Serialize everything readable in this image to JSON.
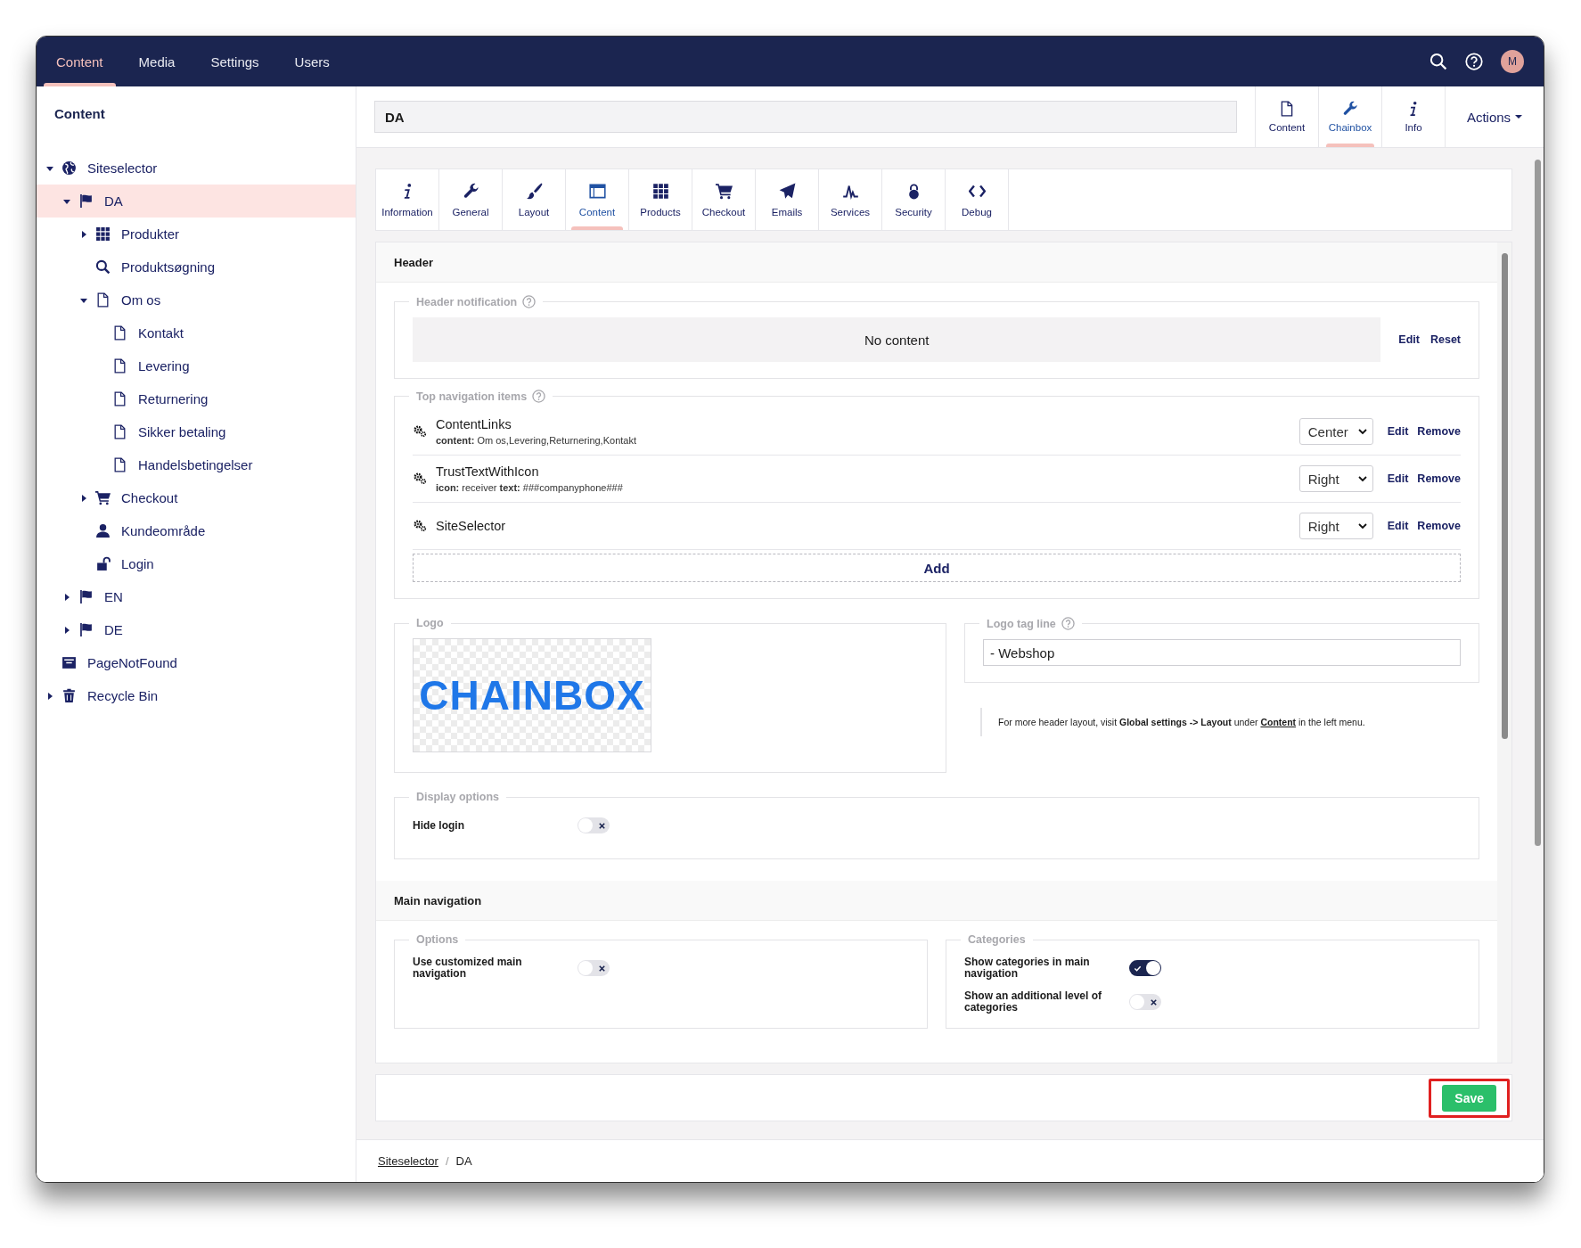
{
  "top_bar": {
    "tabs": [
      {
        "label": "Content",
        "selected": true
      },
      {
        "label": "Media",
        "selected": false
      },
      {
        "label": "Settings",
        "selected": false
      },
      {
        "label": "Users",
        "selected": false
      }
    ],
    "avatar": "M"
  },
  "sidebar": {
    "title": "Content",
    "tree": [
      {
        "label": "Siteselector",
        "kind": "globe",
        "expanded": true,
        "selected": false,
        "children": [
          {
            "label": "DA",
            "kind": "flag",
            "expanded": true,
            "selected": true,
            "children": [
              {
                "label": "Produkter",
                "kind": "grid",
                "expanded": false,
                "selected": false
              },
              {
                "label": "Produktsøgning",
                "kind": "search",
                "selected": false
              },
              {
                "label": "Om os",
                "kind": "page",
                "expanded": true,
                "selected": false,
                "children": [
                  {
                    "label": "Kontakt",
                    "kind": "page",
                    "selected": false
                  },
                  {
                    "label": "Levering",
                    "kind": "page",
                    "selected": false
                  },
                  {
                    "label": "Returnering",
                    "kind": "page",
                    "selected": false
                  },
                  {
                    "label": "Sikker betaling",
                    "kind": "page",
                    "selected": false
                  },
                  {
                    "label": "Handelsbetingelser",
                    "kind": "page",
                    "selected": false
                  }
                ]
              },
              {
                "label": "Checkout",
                "kind": "cart",
                "expanded": false,
                "selected": false
              },
              {
                "label": "Kundeområde",
                "kind": "user",
                "selected": false
              },
              {
                "label": "Login",
                "kind": "unlock",
                "selected": false
              }
            ]
          },
          {
            "label": "EN",
            "kind": "flag",
            "expanded": false,
            "selected": false
          },
          {
            "label": "DE",
            "kind": "flag",
            "expanded": false,
            "selected": false
          }
        ]
      },
      {
        "label": "PageNotFound",
        "kind": "archive",
        "selected": false
      },
      {
        "label": "Recycle Bin",
        "kind": "trash",
        "expanded": false,
        "selected": false
      }
    ]
  },
  "editor": {
    "title": "DA",
    "apps": [
      {
        "label": "Content",
        "kind": "page",
        "selected": false
      },
      {
        "label": "Chainbox",
        "kind": "wrench",
        "selected": true
      },
      {
        "label": "Info",
        "kind": "info",
        "selected": false
      }
    ],
    "actions": "Actions"
  },
  "section_tabs": [
    {
      "label": "Information",
      "kind": "info",
      "selected": false
    },
    {
      "label": "General",
      "kind": "wrench",
      "selected": false
    },
    {
      "label": "Layout",
      "kind": "brush",
      "selected": false
    },
    {
      "label": "Content",
      "kind": "window",
      "selected": true
    },
    {
      "label": "Products",
      "kind": "grid",
      "selected": false
    },
    {
      "label": "Checkout",
      "kind": "cart",
      "selected": false
    },
    {
      "label": "Emails",
      "kind": "plane",
      "selected": false
    },
    {
      "label": "Services",
      "kind": "pulse",
      "selected": false
    },
    {
      "label": "Security",
      "kind": "lock",
      "selected": false
    },
    {
      "label": "Debug",
      "kind": "code",
      "selected": false
    }
  ],
  "header_section": {
    "title": "Header",
    "notification": {
      "legend": "Header notification",
      "empty": "No content",
      "actions": [
        "Edit",
        "Reset"
      ]
    },
    "top_nav": {
      "legend": "Top navigation items",
      "items": [
        {
          "name": "ContentLinks",
          "details": "**content:** Om os,Levering,Returnering,Kontakt",
          "position": "Center",
          "actions": [
            "Edit",
            "Remove"
          ]
        },
        {
          "name": "TrustTextWithIcon",
          "details": "**icon:** receiver **text:** ###companyphone###",
          "position": "Right",
          "actions": [
            "Edit",
            "Remove"
          ]
        },
        {
          "name": "SiteSelector",
          "position": "Right",
          "actions": [
            "Edit",
            "Remove"
          ]
        }
      ],
      "add": "Add"
    },
    "logo": {
      "legend": "Logo",
      "image_text": "CHAINBOX"
    },
    "tag_line": {
      "legend": "Logo tag line",
      "value": "- Webshop"
    },
    "note": {
      "text": "For more header layout, visit **Global settings -> Layout** under",
      "link": "Content",
      "after": "in the left menu."
    },
    "display_options": {
      "legend": "Display options",
      "toggles": [
        {
          "label": "Hide login",
          "on": false
        }
      ]
    }
  },
  "main_navigation": {
    "title": "Main navigation",
    "groups": [
      {
        "legend": "Options",
        "toggles": [
          {
            "label": "Use customized main navigation",
            "on": false
          }
        ]
      },
      {
        "legend": "Categories",
        "toggles": [
          {
            "label": "Show categories in main navigation",
            "on": true
          },
          {
            "label": "Show an additional level of categories",
            "on": false
          }
        ]
      }
    ]
  },
  "save": "Save",
  "breadcrumb": {
    "separator": "/",
    "items": [
      {
        "label": "Siteselector",
        "link": true
      },
      {
        "label": "DA",
        "link": false
      }
    ]
  }
}
